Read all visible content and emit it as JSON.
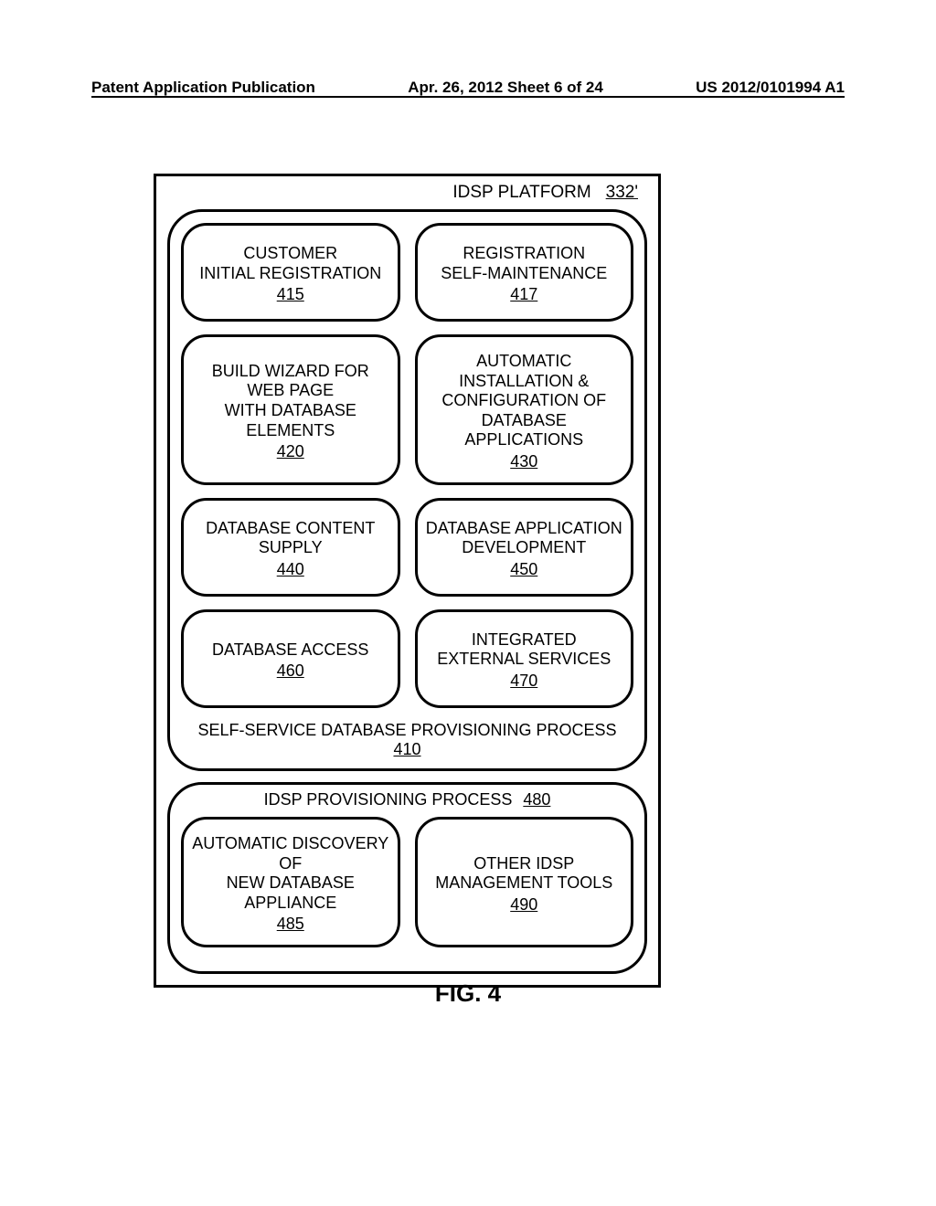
{
  "header": {
    "left": "Patent Application Publication",
    "center": "Apr. 26, 2012  Sheet 6 of 24",
    "right": "US 2012/0101994 A1"
  },
  "platform": {
    "title": "IDSP PLATFORM",
    "ref": "332'"
  },
  "group1": {
    "title": "SELF-SERVICE DATABASE PROVISIONING PROCESS",
    "ref": "410",
    "rows": [
      [
        {
          "label": "CUSTOMER\nINITIAL REGISTRATION",
          "ref": "415"
        },
        {
          "label": "REGISTRATION\nSELF-MAINTENANCE",
          "ref": "417"
        }
      ],
      [
        {
          "label": "BUILD WIZARD FOR WEB PAGE\nWITH DATABASE ELEMENTS",
          "ref": "420"
        },
        {
          "label": "AUTOMATIC INSTALLATION &\nCONFIGURATION OF\nDATABASE APPLICATIONS",
          "ref": "430"
        }
      ],
      [
        {
          "label": "DATABASE CONTENT\nSUPPLY",
          "ref": "440"
        },
        {
          "label": "DATABASE APPLICATION\nDEVELOPMENT",
          "ref": "450"
        }
      ],
      [
        {
          "label": "DATABASE ACCESS",
          "ref": "460"
        },
        {
          "label": "INTEGRATED\nEXTERNAL SERVICES",
          "ref": "470"
        }
      ]
    ]
  },
  "group2": {
    "title": "IDSP PROVISIONING PROCESS",
    "ref": "480",
    "row": [
      {
        "label": "AUTOMATIC DISCOVERY OF\nNEW DATABASE APPLIANCE",
        "ref": "485"
      },
      {
        "label": "OTHER IDSP\nMANAGEMENT TOOLS",
        "ref": "490"
      }
    ]
  },
  "figcap": "FIG. 4"
}
